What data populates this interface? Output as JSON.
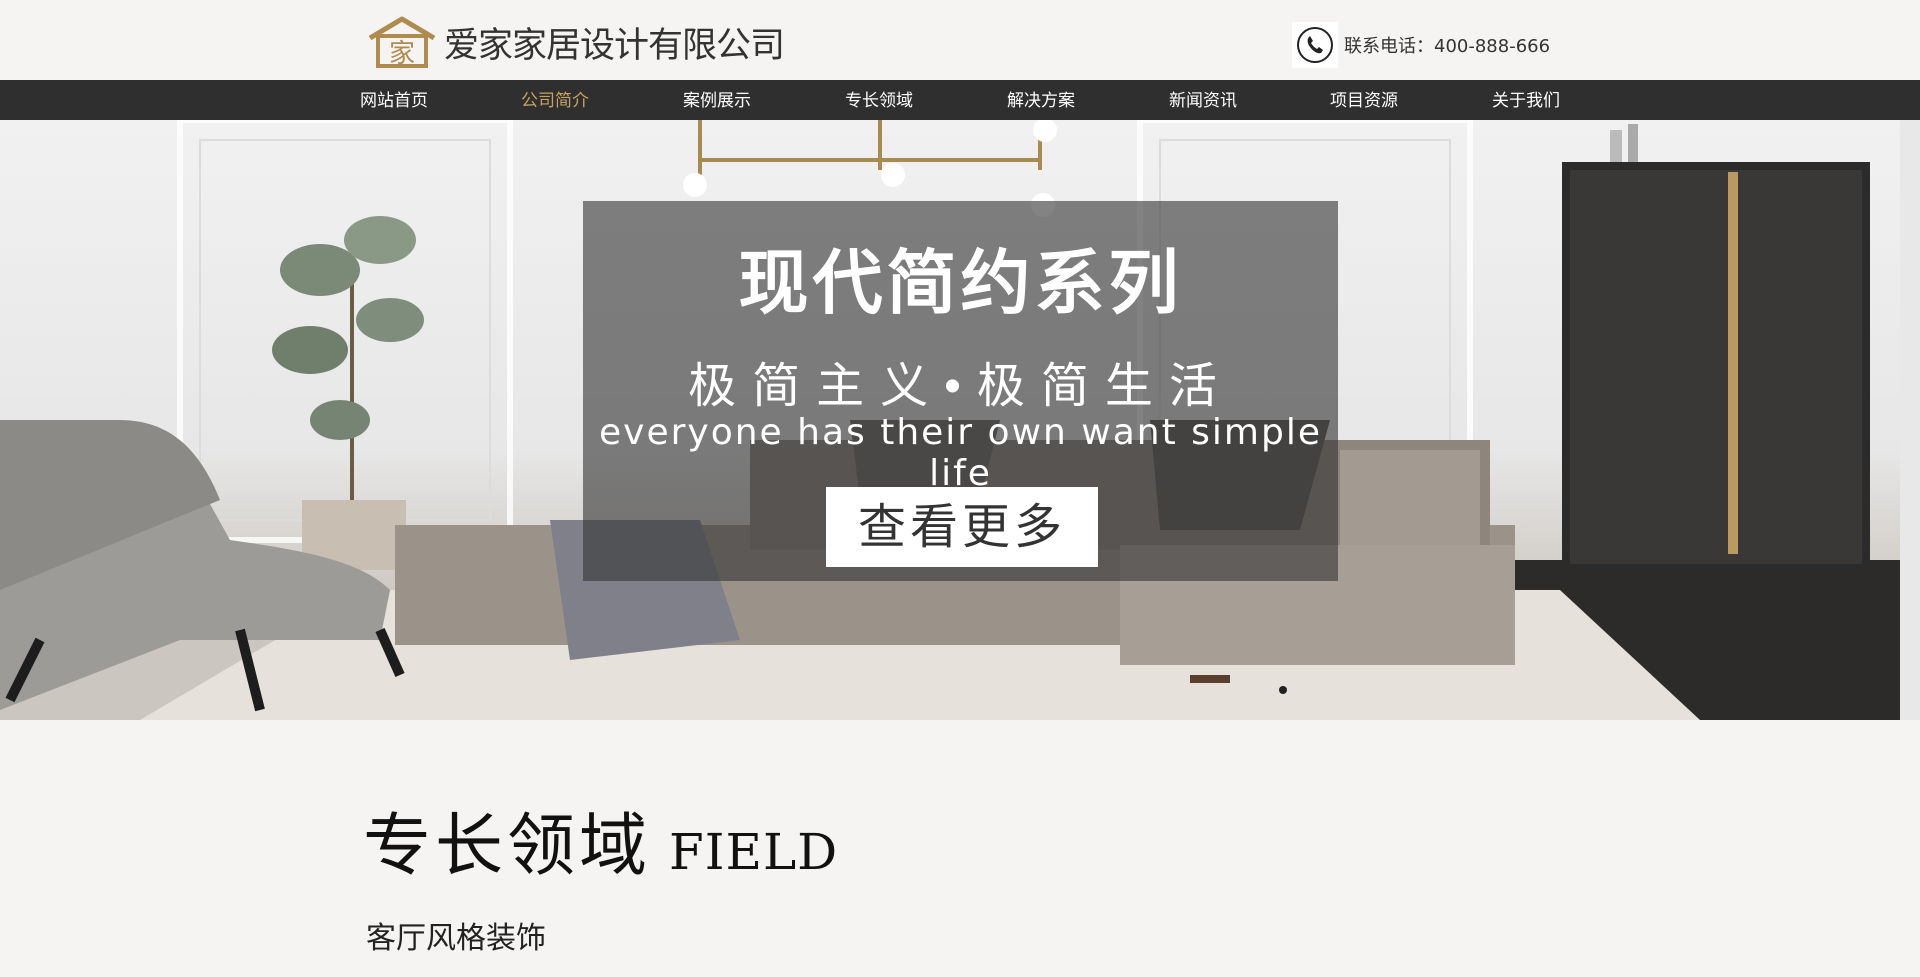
{
  "header": {
    "company_name": "爱家家居设计有限公司",
    "logo_icon": "house-logo-icon",
    "logo_glyph": "家",
    "contact_label": "联系电话：400-888-666",
    "phone_icon": "phone-icon"
  },
  "nav": {
    "items": [
      {
        "label": "网站首页"
      },
      {
        "label": "公司简介",
        "active": true
      },
      {
        "label": "案例展示"
      },
      {
        "label": "专长领域"
      },
      {
        "label": "解决方案"
      },
      {
        "label": "新闻资讯"
      },
      {
        "label": "项目资源"
      },
      {
        "label": "关于我们"
      }
    ]
  },
  "hero": {
    "title": "现代简约系列",
    "subtitle": "极简主义•极简生活",
    "english": "everyone has their own want simple life",
    "button_label": "查看更多"
  },
  "section": {
    "title_cn": "专长领域",
    "title_en": "FIELD",
    "subtitle": "客厅风格装饰"
  },
  "colors": {
    "accent": "#c9a263",
    "nav_bg": "#2f2f2f",
    "page_bg": "#f5f4f2"
  }
}
